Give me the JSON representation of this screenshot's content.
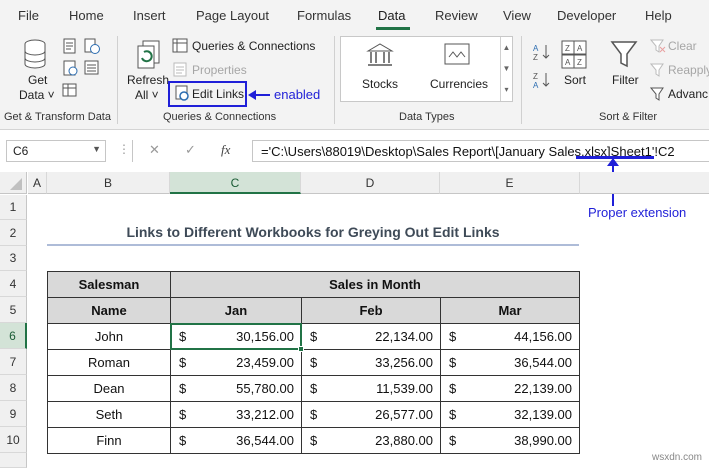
{
  "tabs": [
    "File",
    "Home",
    "Insert",
    "Page Layout",
    "Formulas",
    "Data",
    "Review",
    "View",
    "Developer",
    "Help"
  ],
  "active_tab": "Data",
  "ribbon": {
    "get_data": {
      "line1": "Get",
      "line2": "Data ˅"
    },
    "get_transform_label": "Get & Transform Data",
    "refresh": {
      "line1": "Refresh",
      "line2": "All ˅"
    },
    "queries_connections": "Queries & Connections",
    "properties": "Properties",
    "edit_links": "Edit Links",
    "queries_group_label": "Queries & Connections",
    "stocks": "Stocks",
    "currencies": "Currencies",
    "data_types_label": "Data Types",
    "sort": "Sort",
    "filter": "Filter",
    "clear": "Clear",
    "reapply": "Reapply",
    "advanced": "Advanc",
    "sort_filter_label": "Sort & Filter"
  },
  "annotations": {
    "enabled": "enabled",
    "proper_extension": "Proper extension",
    "color": "#1f1fd8"
  },
  "formula_bar": {
    "name_box": "C6",
    "formula": "='C:\\Users\\88019\\Desktop\\Sales Report\\[January Sales.xlsx]Sheet1'!C2"
  },
  "grid": {
    "columns": [
      "A",
      "B",
      "C",
      "D",
      "E"
    ],
    "selected_column": "C",
    "rows": [
      "1",
      "2",
      "3",
      "4",
      "5",
      "6",
      "7",
      "8",
      "9",
      "10"
    ],
    "selected_row": "6"
  },
  "sheet": {
    "title": "Links to Different Workbooks for Greying Out Edit Links",
    "header_salesman": "Salesman",
    "header_sales_in_month": "Sales in Month",
    "header_name": "Name",
    "months": [
      "Jan",
      "Feb",
      "Mar"
    ],
    "currency_symbol": "$",
    "rows": [
      {
        "name": "John",
        "values": [
          "30,156.00",
          "22,134.00",
          "44,156.00"
        ]
      },
      {
        "name": "Roman",
        "values": [
          "23,459.00",
          "33,256.00",
          "36,544.00"
        ]
      },
      {
        "name": "Dean",
        "values": [
          "55,780.00",
          "11,539.00",
          "22,139.00"
        ]
      },
      {
        "name": "Seth",
        "values": [
          "33,212.00",
          "26,577.00",
          "32,139.00"
        ]
      },
      {
        "name": "Finn",
        "values": [
          "36,544.00",
          "23,880.00",
          "38,990.00"
        ]
      }
    ]
  },
  "watermark": "wsxdn.com"
}
